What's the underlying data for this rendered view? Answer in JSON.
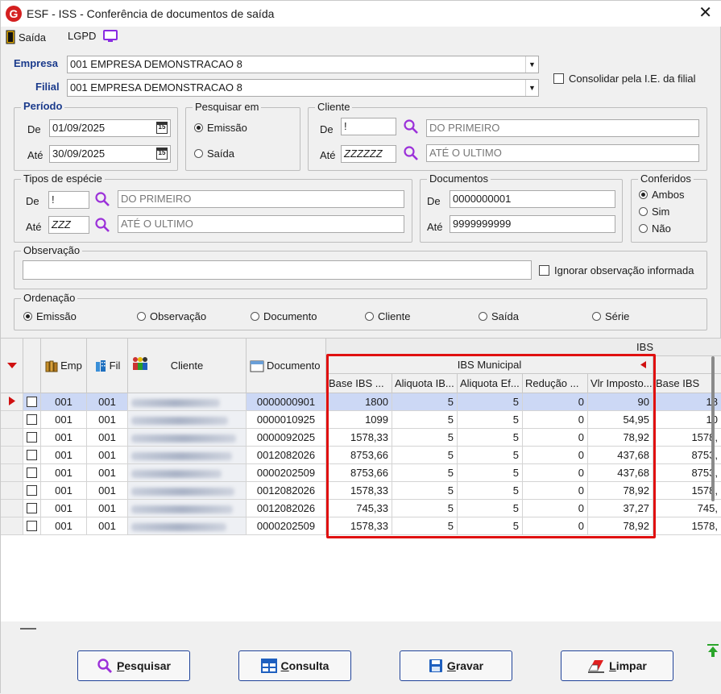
{
  "window": {
    "title": "ESF - ISS - Conferência de documentos de saída",
    "logo_letter": "G"
  },
  "menu": {
    "saida": "Saída",
    "lgpd": "LGPD"
  },
  "empresa": {
    "label": "Empresa",
    "value": "001 EMPRESA DEMONSTRACAO 8"
  },
  "filial": {
    "label": "Filial",
    "value": "001 EMPRESA DEMONSTRACAO 8"
  },
  "consolidar": {
    "label": "Consolidar pela I.E. da filial"
  },
  "periodo": {
    "legend": "Período",
    "de_label": "De",
    "de_value": "01/09/2025",
    "ate_label": "Até",
    "ate_value": "30/09/2025",
    "cal_glyph": "15"
  },
  "pesquisar_em": {
    "legend": "Pesquisar em",
    "emissao": "Emissão",
    "saida": "Saída",
    "selected": "emissao"
  },
  "cliente": {
    "legend": "Cliente",
    "de_label": "De",
    "de_value": "!",
    "de_desc": "DO PRIMEIRO",
    "ate_label": "Até",
    "ate_value": "ZZZZZZ",
    "ate_desc": "ATÉ O ULTIMO"
  },
  "tipos_especie": {
    "legend": "Tipos de espécie",
    "de_label": "De",
    "de_value": "!",
    "de_desc": "DO PRIMEIRO",
    "ate_label": "Até",
    "ate_value": "ZZZ",
    "ate_desc": "ATÉ O ULTIMO"
  },
  "documentos": {
    "legend": "Documentos",
    "de_label": "De",
    "de_value": "0000000001",
    "ate_label": "Até",
    "ate_value": "9999999999"
  },
  "conferidos": {
    "legend": "Conferidos",
    "ambos": "Ambos",
    "sim": "Sim",
    "nao": "Não",
    "selected": "ambos"
  },
  "observacao": {
    "legend": "Observação",
    "value": "",
    "ignorar_label": "Ignorar observação informada"
  },
  "ordenacao": {
    "legend": "Ordenação",
    "options": [
      "Emissão",
      "Observação",
      "Documento",
      "Cliente",
      "Saída",
      "Série"
    ],
    "selected": 0
  },
  "grid": {
    "group_ibs": "IBS",
    "group_ibs_municipal": "IBS Municipal",
    "headers": {
      "emp": "Emp",
      "fil": "Fil",
      "cliente": "Cliente",
      "documento": "Documento",
      "base_ibs": "Base IBS ...",
      "aliquota_ib": "Aliquota IB...",
      "aliquota_ef": "Aliquota Ef...",
      "reducao": "Redução ...",
      "vlr_imposto": "Vlr Imposto...",
      "base_ibs2": "Base IBS"
    },
    "rows": [
      {
        "emp": "001",
        "fil": "001",
        "documento": "0000000901",
        "base": "1800",
        "aliq": "5",
        "aliq_ef": "5",
        "reducao": "0",
        "vlr": "90",
        "base2": "18"
      },
      {
        "emp": "001",
        "fil": "001",
        "documento": "0000010925",
        "base": "1099",
        "aliq": "5",
        "aliq_ef": "5",
        "reducao": "0",
        "vlr": "54,95",
        "base2": "10"
      },
      {
        "emp": "001",
        "fil": "001",
        "documento": "0000092025",
        "base": "1578,33",
        "aliq": "5",
        "aliq_ef": "5",
        "reducao": "0",
        "vlr": "78,92",
        "base2": "1578,"
      },
      {
        "emp": "001",
        "fil": "001",
        "documento": "0012082026",
        "base": "8753,66",
        "aliq": "5",
        "aliq_ef": "5",
        "reducao": "0",
        "vlr": "437,68",
        "base2": "8753,"
      },
      {
        "emp": "001",
        "fil": "001",
        "documento": "0000202509",
        "base": "8753,66",
        "aliq": "5",
        "aliq_ef": "5",
        "reducao": "0",
        "vlr": "437,68",
        "base2": "8753,"
      },
      {
        "emp": "001",
        "fil": "001",
        "documento": "0012082026",
        "base": "1578,33",
        "aliq": "5",
        "aliq_ef": "5",
        "reducao": "0",
        "vlr": "78,92",
        "base2": "1578,"
      },
      {
        "emp": "001",
        "fil": "001",
        "documento": "0012082026",
        "base": "745,33",
        "aliq": "5",
        "aliq_ef": "5",
        "reducao": "0",
        "vlr": "37,27",
        "base2": "745,"
      },
      {
        "emp": "001",
        "fil": "001",
        "documento": "0000202509",
        "base": "1578,33",
        "aliq": "5",
        "aliq_ef": "5",
        "reducao": "0",
        "vlr": "78,92",
        "base2": "1578,"
      }
    ]
  },
  "buttons": {
    "pesquisar": {
      "u": "P",
      "rest": "esquisar"
    },
    "consulta": {
      "u": "C",
      "rest": "onsulta"
    },
    "gravar": {
      "u": "G",
      "rest": "ravar"
    },
    "limpar": {
      "u": "L",
      "rest": "impar"
    }
  },
  "colors": {
    "accent": "#1b3b8c",
    "highlight": "#e01010",
    "selected_row": "#ccd8f5"
  }
}
